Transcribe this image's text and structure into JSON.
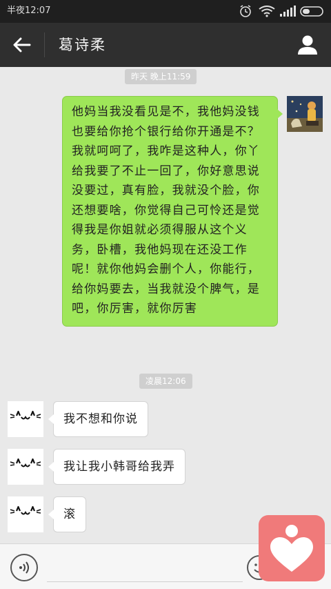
{
  "status_bar": {
    "time": "半夜12:07",
    "icons": [
      "alarm-icon",
      "wifi-icon",
      "signal-icon",
      "battery-icon"
    ]
  },
  "header": {
    "title": "葛诗柔",
    "back_icon": "arrow-left-icon",
    "profile_icon": "person-icon"
  },
  "messages": {
    "timestamp_1": "昨天 晚上11:59",
    "outgoing_1": "他妈当我没看见是不，我他妈没钱也要给你抢个银行给你开通是不？我就呵呵了，我咋是这种人，你丫给我要了不止一回了，你好意思说没要过，真有脸，我就没个脸，你还想要啥，你觉得自己可怜还是觉得我是你姐就必须得服从这个义务，卧槽，我他妈现在还没工作呢！就你他妈会删个人，你能行，给你妈要去，当我就没个脾气，是吧，你厉害，就你厉害",
    "timestamp_2": "凌晨12:06",
    "incoming_1": "我不想和你说",
    "incoming_2": "我让我小韩哥给我弄",
    "incoming_3": "滚"
  },
  "input_bar": {
    "value": "",
    "voice_icon": "voice-icon",
    "emoji_icon": "emoji-icon"
  },
  "floating_app": {
    "icon": "heart-person-icon",
    "color": "#f07a7a"
  },
  "colors": {
    "outgoing_bubble": "#9fe659",
    "title_bar": "#2f2f2f",
    "background": "#e9e9e9"
  }
}
